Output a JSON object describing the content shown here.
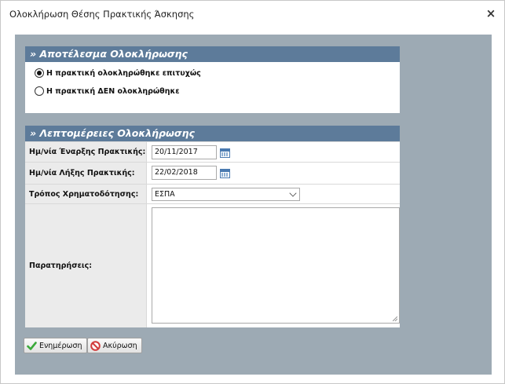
{
  "window": {
    "title": "Ολοκλήρωση Θέσης Πρακτικής Άσκησης",
    "close_label": "×"
  },
  "result_section": {
    "header": "» Αποτέλεσμα Ολοκλήρωσης",
    "options": [
      {
        "label": "Η πρακτική ολοκληρώθηκε επιτυχώς",
        "checked": true
      },
      {
        "label": "Η πρακτική ΔΕΝ ολοκληρώθηκε",
        "checked": false
      }
    ]
  },
  "details_section": {
    "header": "» Λεπτομέρειες Ολοκλήρωσης",
    "start_date_label": "Ημ/νία Έναρξης Πρακτικής:",
    "start_date_value": "20/11/2017",
    "end_date_label": "Ημ/νία Λήξης Πρακτικής:",
    "end_date_value": "22/02/2018",
    "funding_label": "Τρόπος Χρηματοδότησης:",
    "funding_value": "ΕΣΠΑ",
    "notes_label": "Παρατηρήσεις:",
    "notes_value": ""
  },
  "buttons": {
    "update_label": "Ενημέρωση",
    "cancel_label": "Ακύρωση"
  },
  "icons": {
    "calendar": "calendar-icon",
    "check": "checkmark-icon",
    "cancel": "cancel-icon"
  },
  "colors": {
    "content_bg": "#9daab4",
    "section_header_bg": "#5d7b9a",
    "update_icon": "#3aa93a",
    "cancel_icon": "#d23a3a"
  }
}
